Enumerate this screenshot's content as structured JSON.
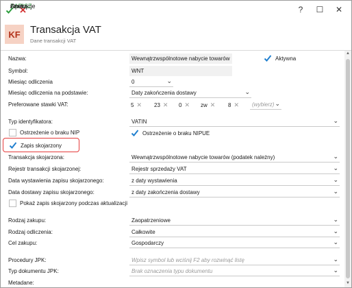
{
  "toolbar": {
    "save": "ZAPISZ",
    "cancel": "Anuluj",
    "operations": "Operacje"
  },
  "window_controls": {
    "help": "?",
    "minimize": "☐",
    "close": "✕"
  },
  "header": {
    "logo": "KF",
    "title": "Transakcja VAT",
    "subtitle": "Dane transakcji VAT"
  },
  "form": {
    "nazwa": {
      "label": "Nazwa:",
      "value": "Wewnątrzwspólnotowe nabycie towarów"
    },
    "aktywna": {
      "label": "Aktywna",
      "checked": true
    },
    "symbol": {
      "label": "Symbol:",
      "value": "WNT"
    },
    "miesiac_odliczenia": {
      "label": "Miesiąc odliczenia",
      "value": "0"
    },
    "miesiac_podstawa": {
      "label": "Miesiąc odliczenia na podstawie:",
      "value": "Daty zakończenia dostawy"
    },
    "stawki": {
      "label": "Preferowane stawki VAT:",
      "values": [
        "5",
        "23",
        "0",
        "zw",
        "8"
      ],
      "placeholder": "(wybierz)"
    },
    "typ_identyfikatora": {
      "label": "Typ identyfikatora:",
      "value": "VATIN"
    },
    "ostrzezenie_nip": {
      "label": "Ostrzeżenie o braku NIP",
      "checked": false
    },
    "ostrzezenie_nipue": {
      "label": "Ostrzeżenie o braku NIPUE",
      "checked": true
    },
    "zapis_skojarzony": {
      "label": "Zapis skojarzony",
      "checked": true
    },
    "transakcja_skojarzona": {
      "label": "Transakcja skojarzona:",
      "value": "Wewnątrzwspólnotowe nabycie towarów (podatek należny)"
    },
    "rejestr": {
      "label": "Rejestr transakcji skojarzonej:",
      "value": "Rejestr sprzedaży VAT"
    },
    "data_wystawienia": {
      "label": "Data wystawienia zapisu skojarzonego:",
      "value": "z daty wystawienia"
    },
    "data_dostawy": {
      "label": "Data dostawy zapisu skojarzonego:",
      "value": "z daty zakończenia dostawy"
    },
    "pokaz_zapis": {
      "label": "Pokaż zapis skojarzony podczas aktualizacji",
      "checked": false
    },
    "rodzaj_zakupu": {
      "label": "Rodzaj zakupu:",
      "value": "Zaopatrzeniowe"
    },
    "rodzaj_odliczenia": {
      "label": "Rodzaj odliczenia:",
      "value": "Całkowite"
    },
    "cel_zakupu": {
      "label": "Cel zakupu:",
      "value": "Gospodarczy"
    },
    "procedury_jpk": {
      "label": "Procedury JPK:",
      "placeholder": "Wpisz symbol lub wciśnij F2 aby rozwinąć listę"
    },
    "typ_dokumentu_jpk": {
      "label": "Typ dokumentu JPK:",
      "placeholder": "Brak oznaczenia typu dokumentu"
    },
    "metadane": {
      "label": "Metadane:"
    }
  },
  "colors": {
    "accent_green": "#2e9e3e",
    "cancel_red": "#d32f2f",
    "check_blue": "#1f7fcf",
    "highlight": "#e53b3b",
    "logo_bg": "#f6d2c4",
    "logo_fg": "#b3321a"
  }
}
